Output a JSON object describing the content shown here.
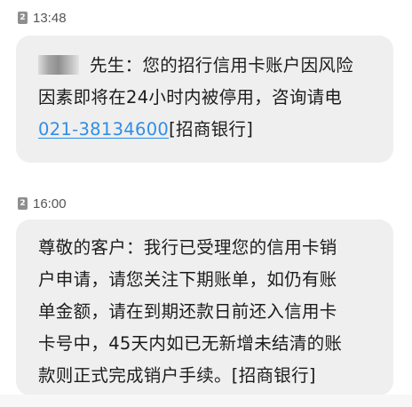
{
  "messages": [
    {
      "sim": "2",
      "time": "13:48",
      "lines": [
        "先生：您的招行信用卡账户因风险",
        "因素即将在24小时内被停用，咨询请电",
        "[招商银行]"
      ],
      "phone": "021-38134600"
    },
    {
      "sim": "2",
      "time": "16:00",
      "lines": [
        "尊敬的客户：我行已受理您的信用卡销",
        "户申请，请您关注下期账单，如仍有账",
        "单金额，请在到期还款日前还入信用卡",
        "卡号中，45天内如已无新增未结清的账",
        "款则正式完成销户手续。[招商银行]"
      ]
    }
  ],
  "colors": {
    "bubble": "#efefef",
    "link": "#2f8ee6",
    "sim_badge": "#8f8f8f"
  }
}
